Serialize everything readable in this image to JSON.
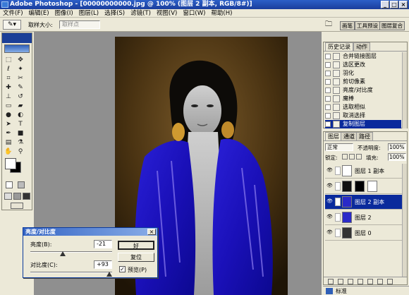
{
  "app": {
    "window_title": "Adobe Photoshop - [00000000000.jpg @ 100% (图层 2 副本, RGB/8#)]",
    "min_label": "_",
    "max_label": "□",
    "close_label": "×"
  },
  "menu": [
    "文件(F)",
    "编辑(E)",
    "图像(I)",
    "图层(L)",
    "选择(S)",
    "滤镜(T)",
    "视图(V)",
    "窗口(W)",
    "帮助(H)"
  ],
  "options_bar": {
    "brush_size_label": "取样大小:",
    "brush_size_value": "取样点",
    "right_tabs": [
      "画笔",
      "工具预设",
      "图层复合"
    ]
  },
  "history_panel": {
    "tabs": [
      "历史记录",
      "动作"
    ],
    "items": [
      {
        "label": "合并链接图层",
        "selected": false
      },
      {
        "label": "选区更改",
        "selected": false
      },
      {
        "label": "羽化",
        "selected": false
      },
      {
        "label": "剪切像素",
        "selected": false
      },
      {
        "label": "亮度/对比度",
        "selected": false
      },
      {
        "label": "魔棒",
        "selected": false
      },
      {
        "label": "选取相似",
        "selected": false
      },
      {
        "label": "取消选择",
        "selected": false
      },
      {
        "label": "复制图层",
        "selected": true
      }
    ]
  },
  "layers_panel": {
    "tabs": [
      "图层",
      "通道",
      "路径"
    ],
    "blend_mode": "正常",
    "opacity_label": "不透明度:",
    "opacity_value": "100%",
    "lock_label": "锁定:",
    "fill_label": "填充:",
    "fill_value": "100%",
    "layers": [
      {
        "name": "图层 1 副本",
        "selected": false
      },
      {
        "name": "图层 2 副本",
        "selected": true
      },
      {
        "name": "图层 2",
        "selected": false
      },
      {
        "name": "图层 0",
        "selected": false
      }
    ]
  },
  "dialog": {
    "title": "亮度/对比度",
    "brightness_label": "亮度(B):",
    "brightness_value": "-21",
    "brightness_fraction": 0.395,
    "contrast_label": "对比度(C):",
    "contrast_value": "+93",
    "contrast_fraction": 0.965,
    "ok_label": "好",
    "reset_label": "复位",
    "preview_label": "预览(P)",
    "preview_checked": true
  },
  "status": {
    "mode_label": "标准"
  }
}
